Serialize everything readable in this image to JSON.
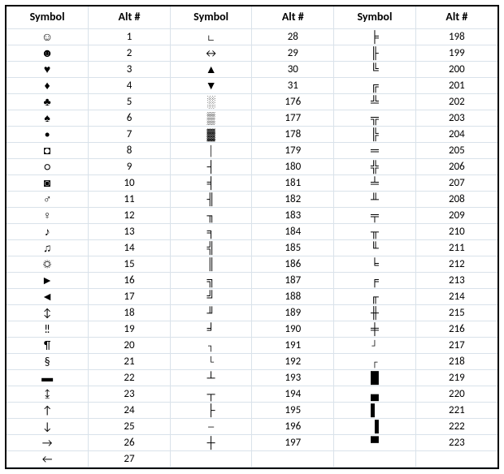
{
  "headers": {
    "symbol": "Symbol",
    "alt": "Alt #"
  },
  "chart_data": {
    "type": "table",
    "title": "Alt Code Symbol Table",
    "columns": [
      "Symbol",
      "Alt #",
      "Symbol",
      "Alt #",
      "Symbol",
      "Alt #"
    ],
    "col1": [
      {
        "symbol": "☺",
        "alt": "1"
      },
      {
        "symbol": "☻",
        "alt": "2"
      },
      {
        "symbol": "♥",
        "alt": "3"
      },
      {
        "symbol": "♦",
        "alt": "4"
      },
      {
        "symbol": "♣",
        "alt": "5"
      },
      {
        "symbol": "♠",
        "alt": "6"
      },
      {
        "symbol": "•",
        "alt": "7"
      },
      {
        "symbol": "◘",
        "alt": "8"
      },
      {
        "symbol": "○",
        "alt": "9"
      },
      {
        "symbol": "◙",
        "alt": "10"
      },
      {
        "symbol": "♂",
        "alt": "11"
      },
      {
        "symbol": "♀",
        "alt": "12"
      },
      {
        "symbol": "♪",
        "alt": "13"
      },
      {
        "symbol": "♫",
        "alt": "14"
      },
      {
        "symbol": "☼",
        "alt": "15"
      },
      {
        "symbol": "►",
        "alt": "16"
      },
      {
        "symbol": "◄",
        "alt": "17"
      },
      {
        "symbol": "↕",
        "alt": "18"
      },
      {
        "symbol": "‼",
        "alt": "19"
      },
      {
        "symbol": "¶",
        "alt": "20"
      },
      {
        "symbol": "§",
        "alt": "21"
      },
      {
        "symbol": "▬",
        "alt": "22"
      },
      {
        "symbol": "↨",
        "alt": "23"
      },
      {
        "symbol": "↑",
        "alt": "24"
      },
      {
        "symbol": "↓",
        "alt": "25"
      },
      {
        "symbol": "→",
        "alt": "26"
      },
      {
        "symbol": "←",
        "alt": "27"
      }
    ],
    "col2": [
      {
        "symbol": "∟",
        "alt": "28"
      },
      {
        "symbol": "↔",
        "alt": "29"
      },
      {
        "symbol": "▲",
        "alt": "30"
      },
      {
        "symbol": "▼",
        "alt": "31"
      },
      {
        "symbol": "░",
        "alt": "176"
      },
      {
        "symbol": "▒",
        "alt": "177"
      },
      {
        "symbol": "▓",
        "alt": "178"
      },
      {
        "symbol": "│",
        "alt": "179"
      },
      {
        "symbol": "┤",
        "alt": "180"
      },
      {
        "symbol": "╡",
        "alt": "181"
      },
      {
        "symbol": "╢",
        "alt": "182"
      },
      {
        "symbol": "╖",
        "alt": "183"
      },
      {
        "symbol": "╕",
        "alt": "184"
      },
      {
        "symbol": "╣",
        "alt": "185"
      },
      {
        "symbol": "║",
        "alt": "186"
      },
      {
        "symbol": "╗",
        "alt": "187"
      },
      {
        "symbol": "╝",
        "alt": "188"
      },
      {
        "symbol": "╜",
        "alt": "189"
      },
      {
        "symbol": "╛",
        "alt": "190"
      },
      {
        "symbol": "┐",
        "alt": "191"
      },
      {
        "symbol": "└",
        "alt": "192"
      },
      {
        "symbol": "┴",
        "alt": "193"
      },
      {
        "symbol": "┬",
        "alt": "194"
      },
      {
        "symbol": "├",
        "alt": "195"
      },
      {
        "symbol": "─",
        "alt": "196"
      },
      {
        "symbol": "┼",
        "alt": "197"
      },
      {
        "symbol": "",
        "alt": ""
      }
    ],
    "col3": [
      {
        "symbol": "╞",
        "alt": "198"
      },
      {
        "symbol": "╟",
        "alt": "199"
      },
      {
        "symbol": "╚",
        "alt": "200"
      },
      {
        "symbol": "╔",
        "alt": "201"
      },
      {
        "symbol": "╩",
        "alt": "202"
      },
      {
        "symbol": "╦",
        "alt": "203"
      },
      {
        "symbol": "╠",
        "alt": "204"
      },
      {
        "symbol": "═",
        "alt": "205"
      },
      {
        "symbol": "╬",
        "alt": "206"
      },
      {
        "symbol": "╧",
        "alt": "207"
      },
      {
        "symbol": "╨",
        "alt": "208"
      },
      {
        "symbol": "╤",
        "alt": "209"
      },
      {
        "symbol": "╥",
        "alt": "210"
      },
      {
        "symbol": "╙",
        "alt": "211"
      },
      {
        "symbol": "╘",
        "alt": "212"
      },
      {
        "symbol": "╒",
        "alt": "213"
      },
      {
        "symbol": "╓",
        "alt": "214"
      },
      {
        "symbol": "╫",
        "alt": "215"
      },
      {
        "symbol": "╪",
        "alt": "216"
      },
      {
        "symbol": "┘",
        "alt": "217"
      },
      {
        "symbol": "┌",
        "alt": "218"
      },
      {
        "symbol": "█",
        "alt": "219"
      },
      {
        "symbol": "▄",
        "alt": "220"
      },
      {
        "symbol": "▌",
        "alt": "221"
      },
      {
        "symbol": "▐",
        "alt": "222"
      },
      {
        "symbol": "▀",
        "alt": "223"
      },
      {
        "symbol": "",
        "alt": ""
      }
    ]
  }
}
